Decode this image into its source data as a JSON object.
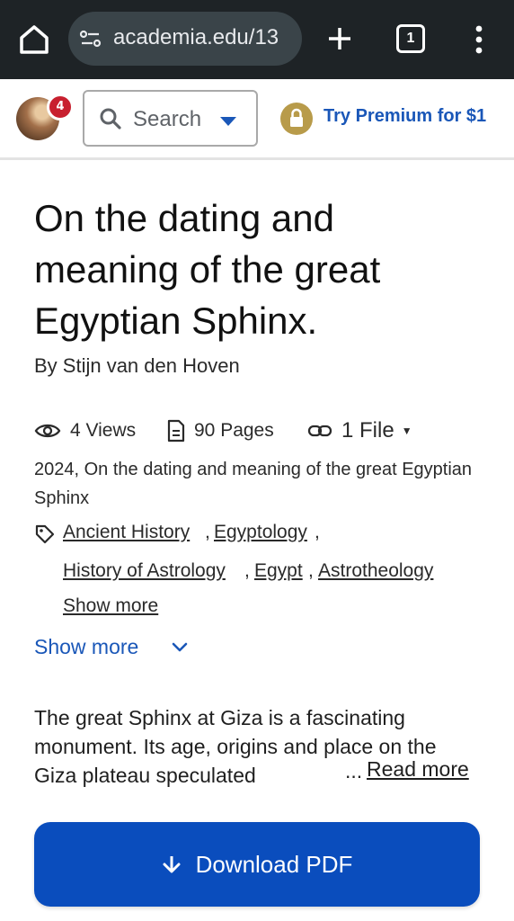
{
  "browser": {
    "url": "academia.edu/13",
    "tab_count": "1"
  },
  "header": {
    "notification_count": "4",
    "search_placeholder": "Search",
    "premium_label": "Try Premium for $1"
  },
  "paper": {
    "title": "On the dating and meaning of the great Egyptian Sphinx.",
    "author": "By Stijn van den Hoven",
    "views": "4 Views",
    "pages": "90 Pages",
    "files": "1 File",
    "citation": "2024, On the dating and meaning of the great Egyptian Sphinx",
    "tags": [
      "Ancient History",
      "Egyptology",
      "History of Astrology",
      "Egypt",
      "Astrotheology"
    ],
    "tags_show_more": "Show more",
    "show_more": "Show more",
    "abstract": "The great Sphinx at Giza is a fascinating monument. Its age, origins and place on the Giza plateau speculated",
    "ellipsis": "...",
    "read_more": "Read more",
    "download_label": "Download PDF"
  },
  "colors": {
    "accent": "#1a57b8",
    "button": "#0a4dbd",
    "badge": "#c8202f",
    "premium_lock": "#b89b4a",
    "chrome": "#1e2326"
  },
  "icons": [
    "home-icon",
    "site-info-icon",
    "plus-icon",
    "tabs-icon",
    "more-vert-icon",
    "search-icon",
    "chevron-down-icon",
    "lock-icon",
    "eye-icon",
    "document-icon",
    "link-icon",
    "tag-icon",
    "arrow-down-icon"
  ]
}
